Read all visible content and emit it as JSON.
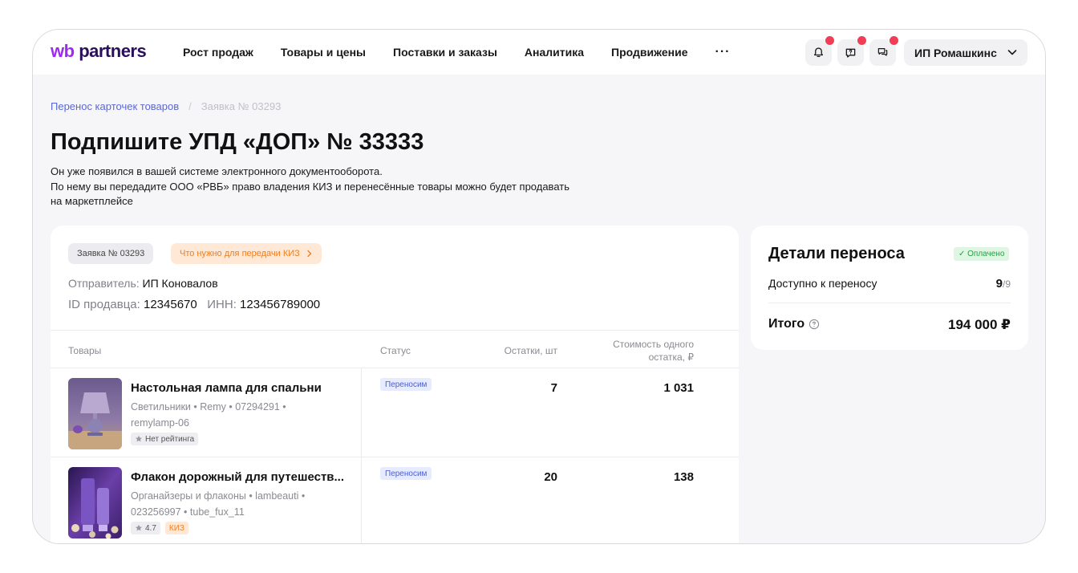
{
  "header": {
    "logo": {
      "wb": "wb",
      "partners": "partners"
    },
    "nav": [
      "Рост продаж",
      "Товары и цены",
      "Поставки и заказы",
      "Аналитика",
      "Продвижение"
    ],
    "more": "···",
    "account": "ИП Ромашкинс"
  },
  "breadcrumb": {
    "link": "Перенос карточек товаров",
    "separator": "/",
    "current": "Заявка № 03293"
  },
  "title": "Подпишите УПД «ДОП» № 33333",
  "description": {
    "line1": "Он уже появился в вашей системе электронного документооборота.",
    "line2": "По нему вы передадите ООО «РВБ» право владения КИЗ и перенесённые товары можно будет продавать",
    "line3": "на маркетплейсе"
  },
  "request": {
    "chip": "Заявка № 03293",
    "kiz_link": "Что нужно для передачи КИЗ",
    "sender_label": "Отправитель:",
    "sender": "ИП Коновалов",
    "seller_id_label": "ID продавца:",
    "seller_id": "12345670",
    "inn_label": "ИНН:",
    "inn": "123456789000"
  },
  "table": {
    "headers": {
      "goods": "Товары",
      "status": "Статус",
      "stock": "Остатки, шт",
      "price_line1": "Стоимость одного",
      "price_line2": "остатка, ₽"
    },
    "rows": [
      {
        "name": "Настольная лампа для спальни",
        "meta_line1": "Светильники • Remy • 07294291 •",
        "meta_line2": "remylamp-06",
        "rating": "Нет рейтинга",
        "status": "Переносим",
        "stock": "7",
        "price": "1 031"
      },
      {
        "name": "Флакон дорожный для путешеств...",
        "meta_line1": "Органайзеры и флаконы • lambeauti •",
        "meta_line2": "023256997 • tube_fux_11",
        "rating": "4.7",
        "kiz": "КИЗ",
        "status": "Переносим",
        "stock": "20",
        "price": "138"
      }
    ]
  },
  "details": {
    "title": "Детали переноса",
    "paid": "✓ Оплачено",
    "available_label": "Доступно к переносу",
    "available": "9",
    "available_total": "/9",
    "total_label": "Итого",
    "total": "194 000 ₽"
  },
  "colors": {
    "accent": "#9b2bf0",
    "link": "#5a67d8",
    "notification_dot": "#f23d55",
    "status_blue": "#4a5fd9",
    "paid_green": "#27a045",
    "kiz_orange": "#f07d1f"
  },
  "icons": [
    "bell-icon",
    "question-chat-icon",
    "messages-icon",
    "chevron-down-icon",
    "star-icon",
    "info-circle-icon"
  ]
}
